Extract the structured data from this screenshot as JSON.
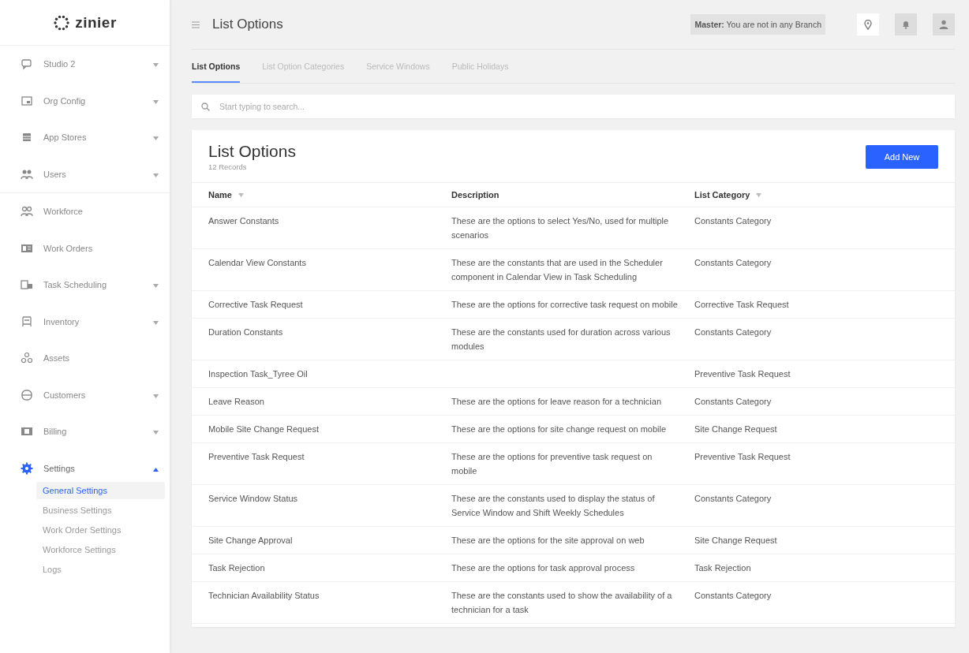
{
  "sidebar": {
    "logo": "zinier",
    "items": [
      {
        "label": "Studio 2",
        "expanded": false,
        "selected": false
      },
      {
        "label": "Org Config",
        "expanded": false,
        "selected": false
      },
      {
        "label": "App Stores",
        "expanded": false,
        "selected": false
      },
      {
        "label": "Users",
        "expanded": false,
        "selected": false
      },
      {
        "label": "Workforce",
        "selected": false
      },
      {
        "label": "Work Orders",
        "selected": false
      },
      {
        "label": "Task Scheduling",
        "expanded": false,
        "selected": false
      },
      {
        "label": "Inventory",
        "expanded": false,
        "selected": false
      },
      {
        "label": "Assets",
        "selected": false
      },
      {
        "label": "Customers",
        "expanded": false,
        "selected": false
      },
      {
        "label": "Billing",
        "expanded": false,
        "selected": false
      },
      {
        "label": "Settings",
        "expanded": true,
        "selected": true,
        "children": [
          {
            "label": "General Settings",
            "selected": true
          },
          {
            "label": "Business Settings",
            "selected": false
          },
          {
            "label": "Work Order Settings",
            "selected": false
          },
          {
            "label": "Workforce Settings",
            "selected": false
          },
          {
            "label": "Logs",
            "selected": false
          }
        ]
      }
    ]
  },
  "header": {
    "title": "List Options",
    "branch": "**Master:** You are not in any Branch"
  },
  "tabs": [
    {
      "label": "List Options",
      "selected": true
    },
    {
      "label": "List Option Categories",
      "selected": false
    },
    {
      "label": "Service Windows",
      "selected": false
    },
    {
      "label": "Public Holidays",
      "selected": false
    }
  ],
  "search": {
    "placeholder": "Start typing to search..."
  },
  "list": {
    "title": "List Options",
    "count": "12 Records",
    "add_button": "Add New",
    "columns": [
      {
        "label": "Name",
        "sortable": true
      },
      {
        "label": "Description",
        "sortable": false
      },
      {
        "label": "List Category",
        "sortable": true
      }
    ],
    "rows": [
      [
        "Answer Constants",
        "These are the options to select Yes/No, used for multiple scenarios",
        "Constants Category"
      ],
      [
        "Calendar View Constants",
        "These are the constants that are used in the Scheduler component in Calendar View in Task Scheduling",
        "Constants Category"
      ],
      [
        "Corrective Task Request",
        "These are the options for corrective task request on mobile",
        "Corrective Task Request"
      ],
      [
        "Duration Constants",
        "These are the constants used for duration across various modules",
        "Constants Category"
      ],
      [
        "Inspection Task_Tyree Oil",
        null,
        "Preventive Task Request"
      ],
      [
        "Leave Reason",
        "These are the options for leave reason for a technician",
        "Constants Category"
      ],
      [
        "Mobile Site Change Request",
        "These are the options for site change request on mobile",
        "Site Change Request"
      ],
      [
        "Preventive Task Request",
        "These are the options for preventive task request on mobile",
        "Preventive Task Request"
      ],
      [
        "Service Window Status",
        "These are the constants used to display the status of Service Window and Shift Weekly Schedules",
        "Constants Category"
      ],
      [
        "Site Change Approval",
        "These are the options for the site approval on web",
        "Site Change Request"
      ],
      [
        "Task Rejection",
        "These are the options for task approval process",
        "Task Rejection"
      ],
      [
        "Technician Availability Status",
        "These are the constants used to show the availability of a technician for a task",
        "Constants Category"
      ]
    ]
  }
}
